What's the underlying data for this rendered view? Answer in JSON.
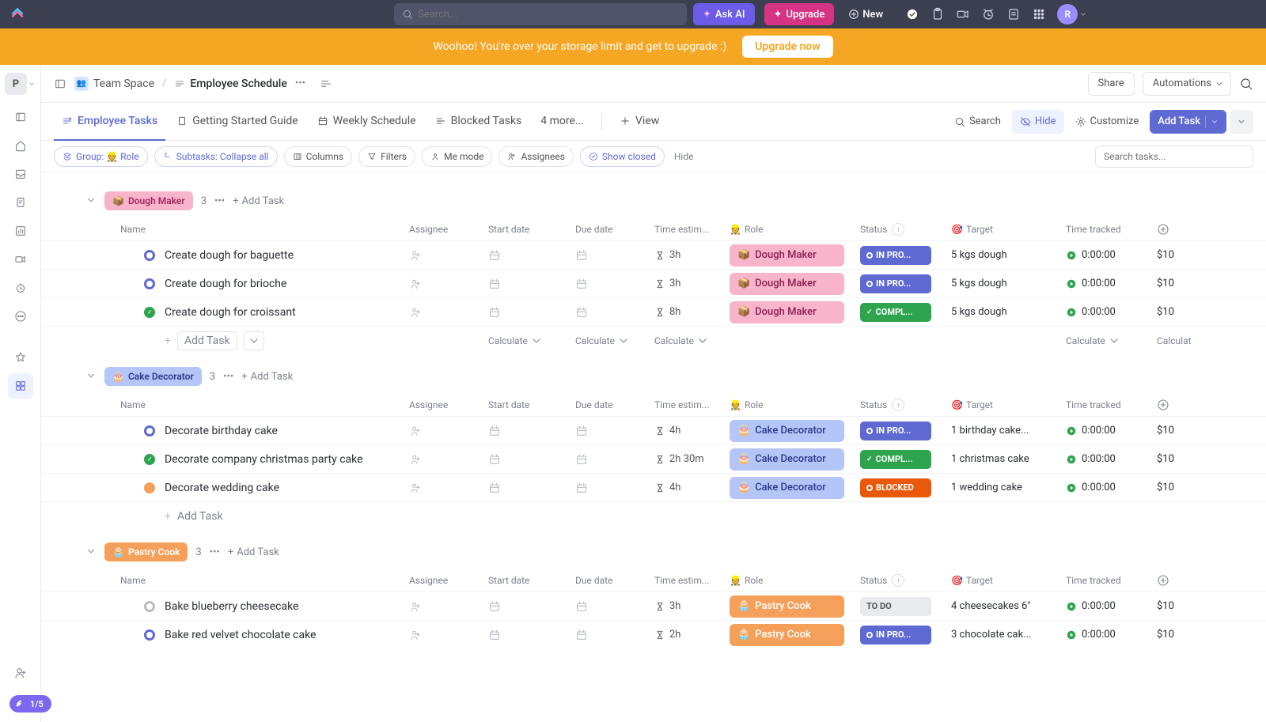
{
  "topbar": {
    "search_placeholder": "Search...",
    "ask_ai": "Ask AI",
    "upgrade": "Upgrade",
    "new": "New",
    "avatar_letter": "R"
  },
  "banner": {
    "text": "Woohoo! You're over your storage limit and get to upgrade :)",
    "button": "Upgrade now"
  },
  "workspace_letter": "P",
  "progress_pill": "1/5",
  "breadcrumb": {
    "space": "Team Space",
    "page": "Employee Schedule",
    "share": "Share",
    "automations": "Automations"
  },
  "tabs": {
    "employee_tasks": "Employee Tasks",
    "getting_started": "Getting Started Guide",
    "weekly_schedule": "Weekly Schedule",
    "blocked_tasks": "Blocked Tasks",
    "more": "4 more...",
    "view": "View"
  },
  "tools": {
    "search": "Search",
    "hide": "Hide",
    "customize": "Customize",
    "add_task": "Add Task"
  },
  "chips": {
    "group": "Group: 👷 Role",
    "subtasks": "Subtasks: Collapse all",
    "columns": "Columns",
    "filters": "Filters",
    "me_mode": "Me mode",
    "assignees": "Assignees",
    "show_closed": "Show closed",
    "hide": "Hide",
    "search_tasks": "Search tasks..."
  },
  "columns": {
    "name": "Name",
    "assignee": "Assignee",
    "start_date": "Start date",
    "due_date": "Due date",
    "time_estimate": "Time estim...",
    "role": "Role",
    "status": "Status",
    "target": "Target",
    "time_tracked": "Time tracked"
  },
  "calc": "Calculate",
  "add_task_label": "+ Add Task",
  "add_task_plain": "Add Task",
  "groups": [
    {
      "id": "dough",
      "emoji": "📦",
      "label": "Dough Maker",
      "pill_class": "pill-dough",
      "role_class": "rb-dough",
      "count": "3",
      "tasks": [
        {
          "name": "Create dough for baguette",
          "dot": "dot-progress",
          "time": "3h",
          "role": "Dough Maker",
          "role_emoji": "📦",
          "status": "IN PRO...",
          "status_class": "sb-progress",
          "target": "5 kgs dough",
          "track": "0:00:00",
          "cost": "$10"
        },
        {
          "name": "Create dough for brioche",
          "dot": "dot-progress",
          "time": "3h",
          "role": "Dough Maker",
          "role_emoji": "📦",
          "status": "IN PRO...",
          "status_class": "sb-progress",
          "target": "5 kgs dough",
          "track": "0:00:00",
          "cost": "$10"
        },
        {
          "name": "Create dough for croissant",
          "dot": "dot-complete",
          "time": "8h",
          "role": "Dough Maker",
          "role_emoji": "📦",
          "status": "COMPL...",
          "status_class": "sb-complete",
          "target": "5 kgs dough",
          "track": "0:00:00",
          "cost": "$10"
        }
      ]
    },
    {
      "id": "cake",
      "emoji": "🎂",
      "label": "Cake Decorator",
      "pill_class": "pill-cake",
      "role_class": "rb-cake",
      "count": "3",
      "tasks": [
        {
          "name": "Decorate birthday cake",
          "dot": "dot-progress",
          "time": "4h",
          "role": "Cake Decorator",
          "role_emoji": "🎂",
          "status": "IN PRO...",
          "status_class": "sb-progress",
          "target": "1 birthday cake...",
          "track": "0:00:00",
          "cost": "$10"
        },
        {
          "name": "Decorate company christmas party cake",
          "dot": "dot-complete",
          "time": "2h 30m",
          "role": "Cake Decorator",
          "role_emoji": "🎂",
          "status": "COMPL...",
          "status_class": "sb-complete",
          "target": "1 christmas cake",
          "track": "0:00:00",
          "cost": "$10"
        },
        {
          "name": "Decorate wedding cake",
          "dot": "dot-blocked",
          "time": "4h",
          "role": "Cake Decorator",
          "role_emoji": "🎂",
          "status": "BLOCKED",
          "status_class": "sb-blocked",
          "target": "1 wedding cake",
          "track": "0:00:00",
          "cost": "$10"
        }
      ]
    },
    {
      "id": "pastry",
      "emoji": "🧁",
      "label": "Pastry Cook",
      "pill_class": "pill-pastry",
      "role_class": "rb-pastry",
      "count": "3",
      "tasks": [
        {
          "name": "Bake blueberry cheesecake",
          "dot": "dot-todo",
          "time": "3h",
          "role": "Pastry Cook",
          "role_emoji": "🧁",
          "status": "TO DO",
          "status_class": "sb-todo",
          "target": "4 cheesecakes 6\"",
          "track": "0:00:00",
          "cost": "$10"
        },
        {
          "name": "Bake red velvet chocolate cake",
          "dot": "dot-progress",
          "time": "2h",
          "role": "Pastry Cook",
          "role_emoji": "🧁",
          "status": "IN PRO...",
          "status_class": "sb-progress",
          "target": "3 chocolate cak...",
          "track": "0:00:00",
          "cost": "$10"
        }
      ]
    }
  ]
}
